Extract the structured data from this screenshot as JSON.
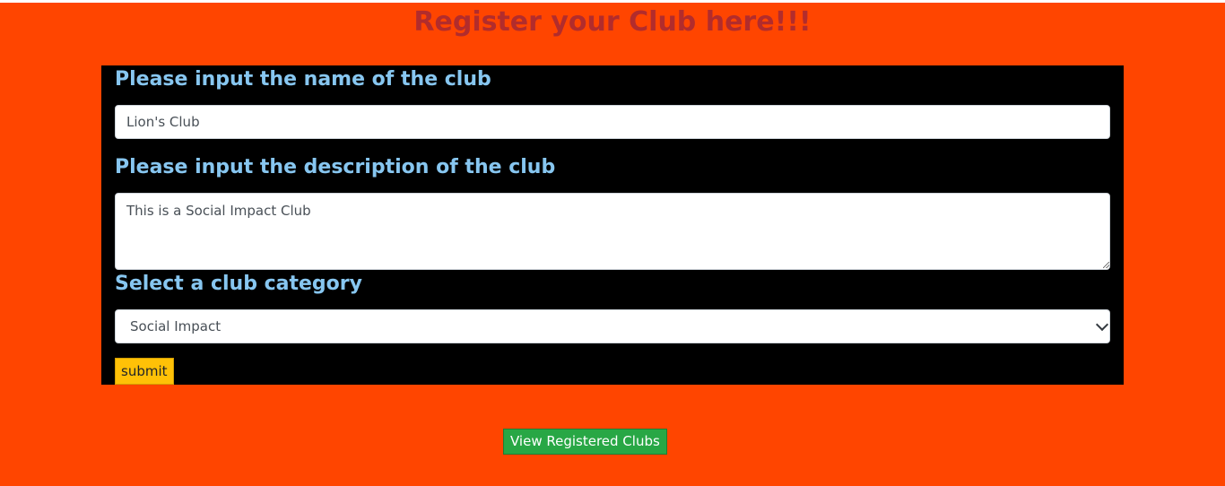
{
  "page": {
    "title": "Register your Club here!!!"
  },
  "form": {
    "name_label": "Please input the name of the club",
    "name_value": "Lion's Club",
    "description_label": "Please input the description of the club",
    "description_value": "This is a Social Impact Club",
    "category_label": "Select a club category",
    "category_selected": "Social Impact",
    "submit_label": "submit"
  },
  "footer": {
    "view_label": "View Registered Clubs"
  },
  "colors": {
    "background": "#ff4500",
    "title": "#b22c2c",
    "panel": "#000000",
    "label": "#87c6f0",
    "submit": "#ffc107",
    "view_button": "#28a745"
  }
}
